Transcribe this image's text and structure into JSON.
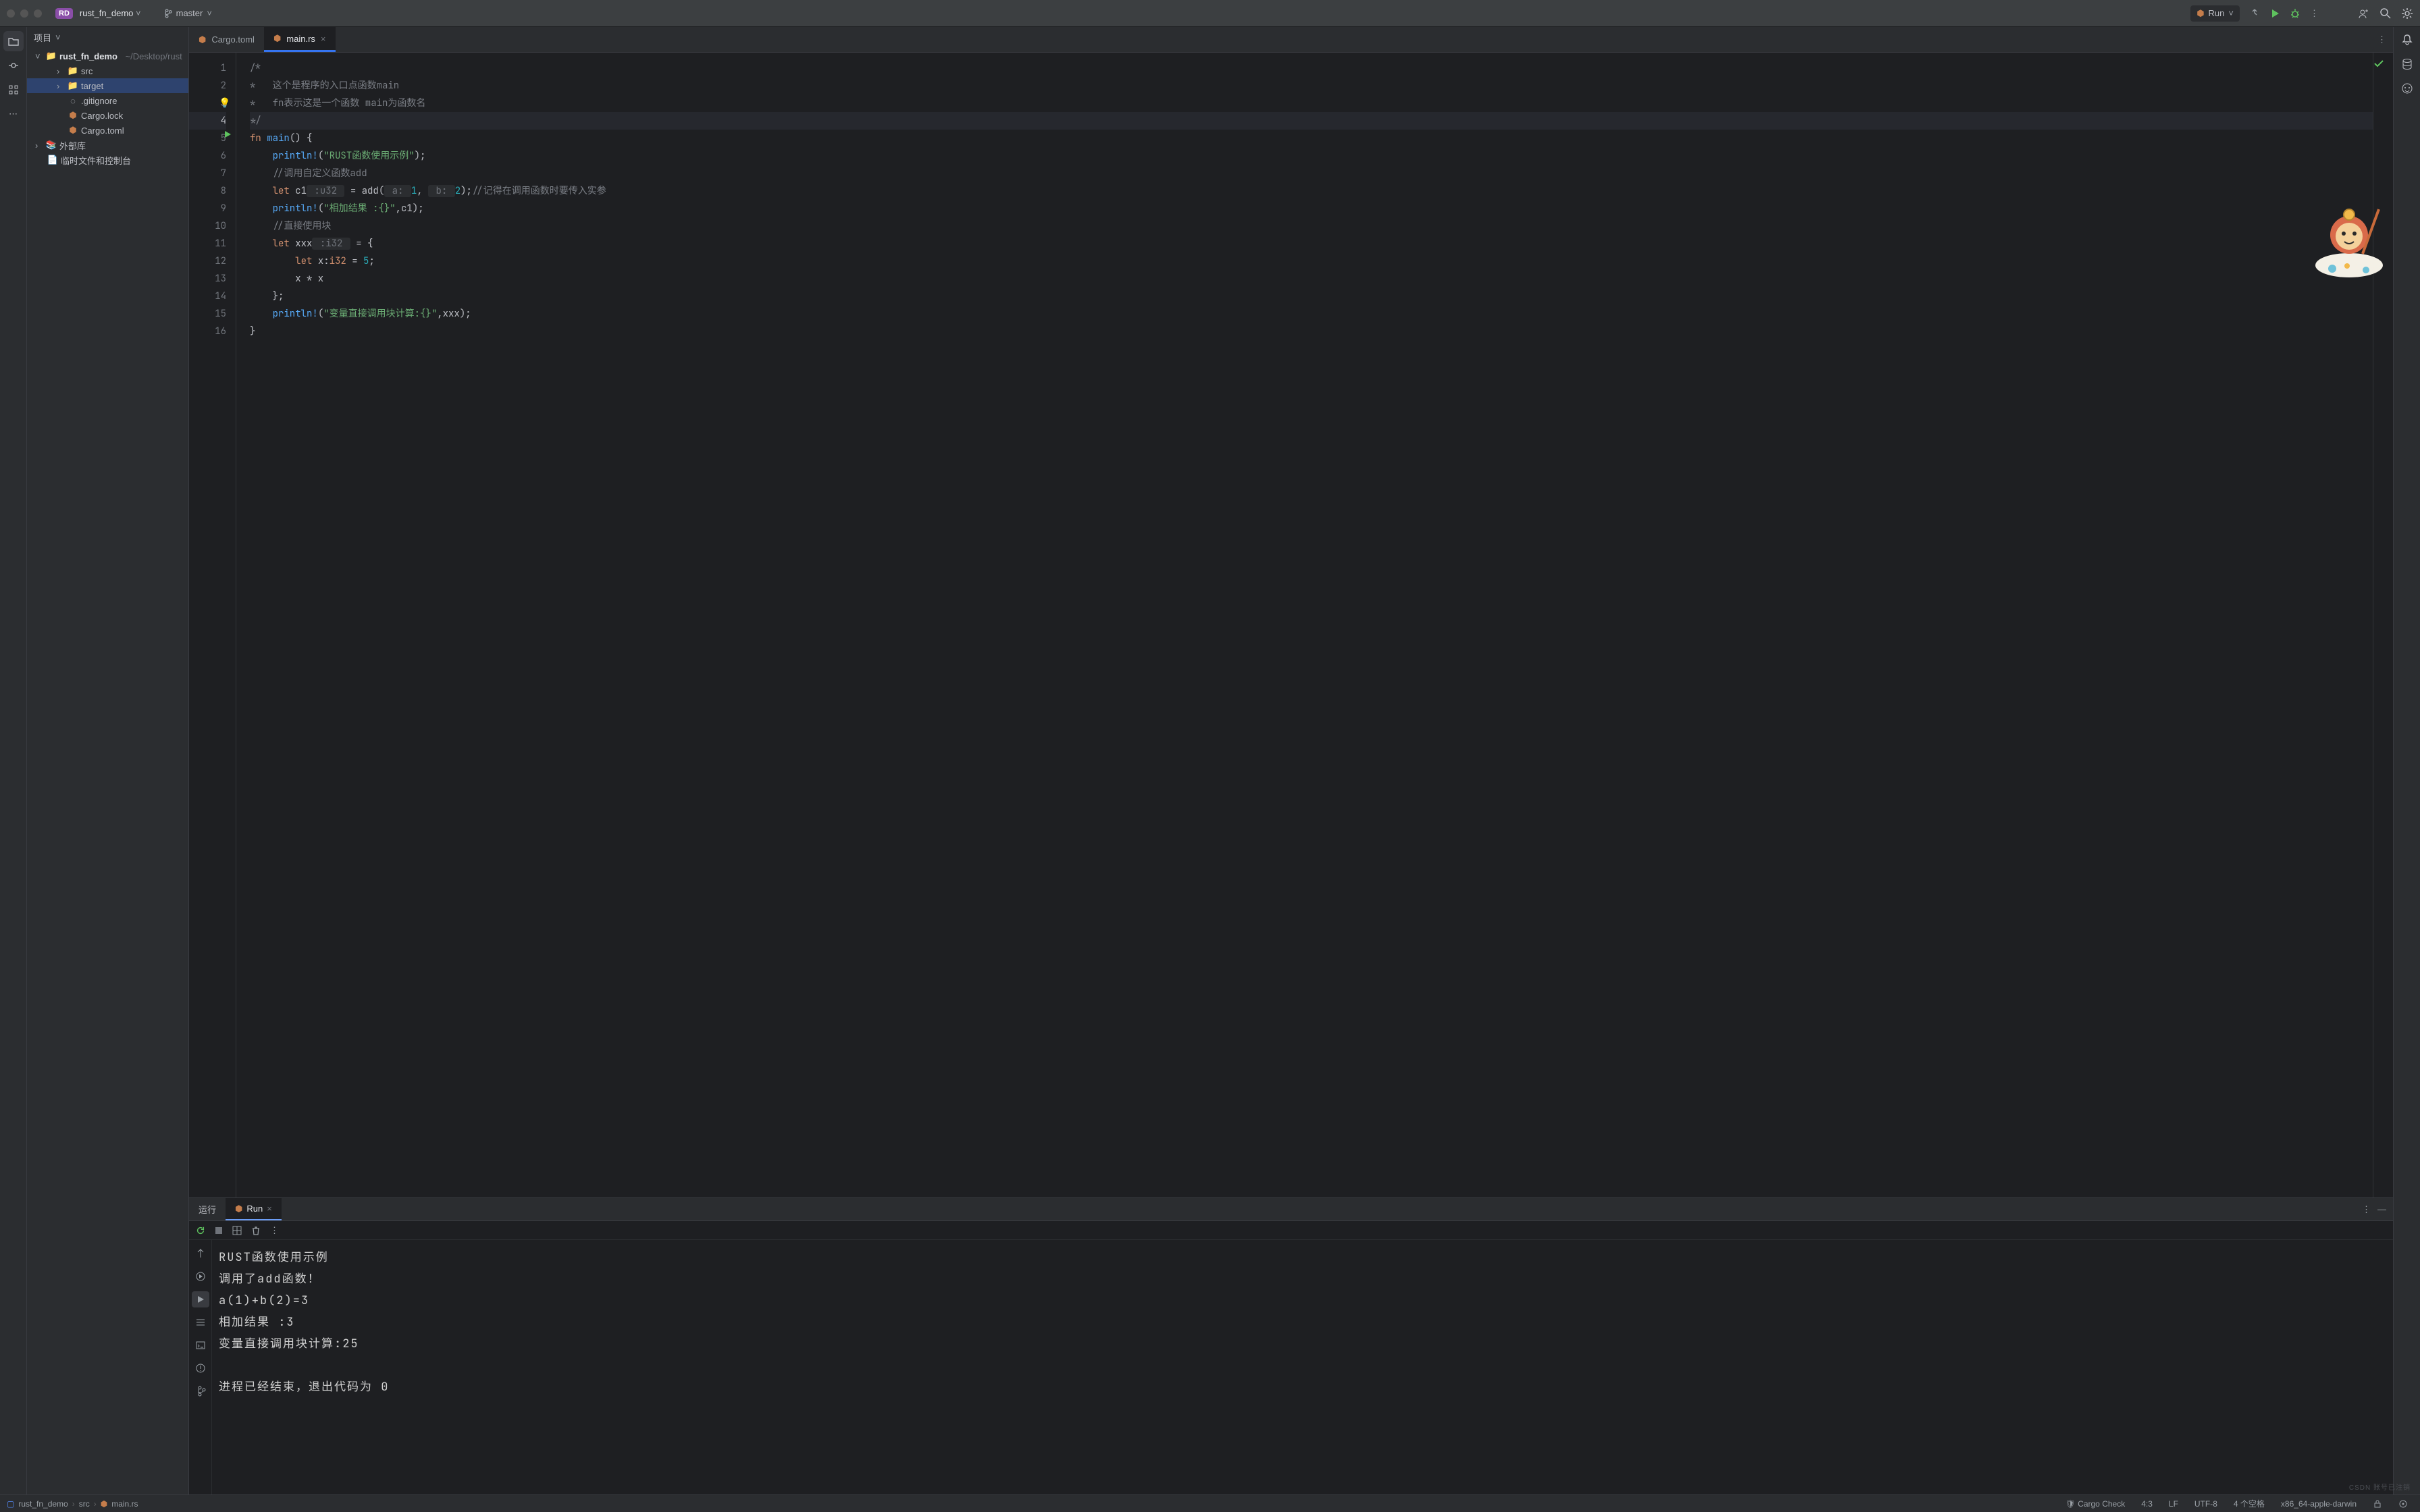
{
  "titlebar": {
    "badge": "RD",
    "project": "rust_fn_demo",
    "branch": "master",
    "run_label": "Run"
  },
  "project_pane": {
    "header": "项目",
    "tree": {
      "root": "rust_fn_demo",
      "root_path": "~/Desktop/rust",
      "items": [
        {
          "name": "src",
          "depth": 1,
          "icon": "folder",
          "expandable": true
        },
        {
          "name": "target",
          "depth": 1,
          "icon": "folder",
          "expandable": true,
          "selected": true
        },
        {
          "name": ".gitignore",
          "depth": 1,
          "icon": "gitignore"
        },
        {
          "name": "Cargo.lock",
          "depth": 1,
          "icon": "cargo"
        },
        {
          "name": "Cargo.toml",
          "depth": 1,
          "icon": "cargo"
        }
      ],
      "ext_libs": "外部库",
      "scratches": "临时文件和控制台"
    }
  },
  "tabs": [
    {
      "label": "Cargo.toml",
      "icon": "cargo",
      "active": false
    },
    {
      "label": "main.rs",
      "icon": "rust",
      "active": true,
      "closeable": true
    }
  ],
  "editor": {
    "current_line": 4,
    "lines": [
      {
        "n": 1,
        "segs": [
          {
            "t": "/*",
            "c": "comment"
          }
        ]
      },
      {
        "n": 2,
        "segs": [
          {
            "t": "*   这个是程序的入口点函数main",
            "c": "comment"
          }
        ]
      },
      {
        "n": 3,
        "bulb": true,
        "segs": [
          {
            "t": "*   fn表示这是一个函数 main为函数名",
            "c": "comment"
          }
        ]
      },
      {
        "n": 4,
        "current": true,
        "segs": [
          {
            "t": "*/",
            "c": "comment"
          }
        ]
      },
      {
        "n": 5,
        "play": true,
        "segs": [
          {
            "t": "fn ",
            "c": "kw"
          },
          {
            "t": "main",
            "c": "fn"
          },
          {
            "t": "() {",
            "c": ""
          }
        ]
      },
      {
        "n": 6,
        "segs": [
          {
            "t": "    ",
            "c": ""
          },
          {
            "t": "println!",
            "c": "macro"
          },
          {
            "t": "(",
            "c": ""
          },
          {
            "t": "\"RUST函数使用示例\"",
            "c": "str"
          },
          {
            "t": ");",
            "c": ""
          }
        ]
      },
      {
        "n": 7,
        "segs": [
          {
            "t": "    ",
            "c": ""
          },
          {
            "t": "//调用自定义函数add",
            "c": "comment"
          }
        ]
      },
      {
        "n": 8,
        "segs": [
          {
            "t": "    ",
            "c": ""
          },
          {
            "t": "let ",
            "c": "kw"
          },
          {
            "t": "c1",
            "c": ""
          },
          {
            "t": " :u32 ",
            "c": "hint"
          },
          {
            "t": " = add(",
            "c": ""
          },
          {
            "t": " a: ",
            "c": "hint"
          },
          {
            "t": "1",
            "c": "num"
          },
          {
            "t": ", ",
            "c": ""
          },
          {
            "t": " b: ",
            "c": "hint"
          },
          {
            "t": "2",
            "c": "num"
          },
          {
            "t": ");",
            "c": ""
          },
          {
            "t": "//记得在调用函数时要传入实参",
            "c": "comment"
          }
        ]
      },
      {
        "n": 9,
        "segs": [
          {
            "t": "    ",
            "c": ""
          },
          {
            "t": "println!",
            "c": "macro"
          },
          {
            "t": "(",
            "c": ""
          },
          {
            "t": "\"相加结果 :{}\"",
            "c": "str"
          },
          {
            "t": ",c1);",
            "c": ""
          }
        ]
      },
      {
        "n": 10,
        "segs": [
          {
            "t": "    ",
            "c": ""
          },
          {
            "t": "//直接使用块",
            "c": "comment"
          }
        ]
      },
      {
        "n": 11,
        "segs": [
          {
            "t": "    ",
            "c": ""
          },
          {
            "t": "let ",
            "c": "kw"
          },
          {
            "t": "xxx",
            "c": ""
          },
          {
            "t": " :i32 ",
            "c": "hint"
          },
          {
            "t": " = {",
            "c": ""
          }
        ]
      },
      {
        "n": 12,
        "segs": [
          {
            "t": "        ",
            "c": ""
          },
          {
            "t": "let ",
            "c": "kw"
          },
          {
            "t": "x:",
            "c": ""
          },
          {
            "t": "i32",
            "c": "kw"
          },
          {
            "t": " = ",
            "c": ""
          },
          {
            "t": "5",
            "c": "num"
          },
          {
            "t": ";",
            "c": ""
          }
        ]
      },
      {
        "n": 13,
        "segs": [
          {
            "t": "        x * x",
            "c": ""
          }
        ]
      },
      {
        "n": 14,
        "segs": [
          {
            "t": "    };",
            "c": ""
          }
        ]
      },
      {
        "n": 15,
        "segs": [
          {
            "t": "    ",
            "c": ""
          },
          {
            "t": "println!",
            "c": "macro"
          },
          {
            "t": "(",
            "c": ""
          },
          {
            "t": "\"变量直接调用块计算:{}\"",
            "c": "str"
          },
          {
            "t": ",xxx);",
            "c": ""
          }
        ]
      },
      {
        "n": 16,
        "segs": [
          {
            "t": "}",
            "c": ""
          }
        ]
      }
    ]
  },
  "run_panel": {
    "tab1": "运行",
    "tab2": "Run",
    "output": [
      "RUST函数使用示例",
      "调用了add函数！",
      "a(1)+b(2)=3",
      "相加结果 :3",
      "变量直接调用块计算:25",
      "",
      "进程已经结束，退出代码为 0"
    ]
  },
  "statusbar": {
    "crumbs": [
      "rust_fn_demo",
      "src",
      "main.rs"
    ],
    "cargo_check": "Cargo Check",
    "pos": "4:3",
    "eol": "LF",
    "encoding": "UTF-8",
    "indent": "4 个空格",
    "target": "x86_64-apple-darwin"
  },
  "watermark": "CSDN 账号已注销"
}
